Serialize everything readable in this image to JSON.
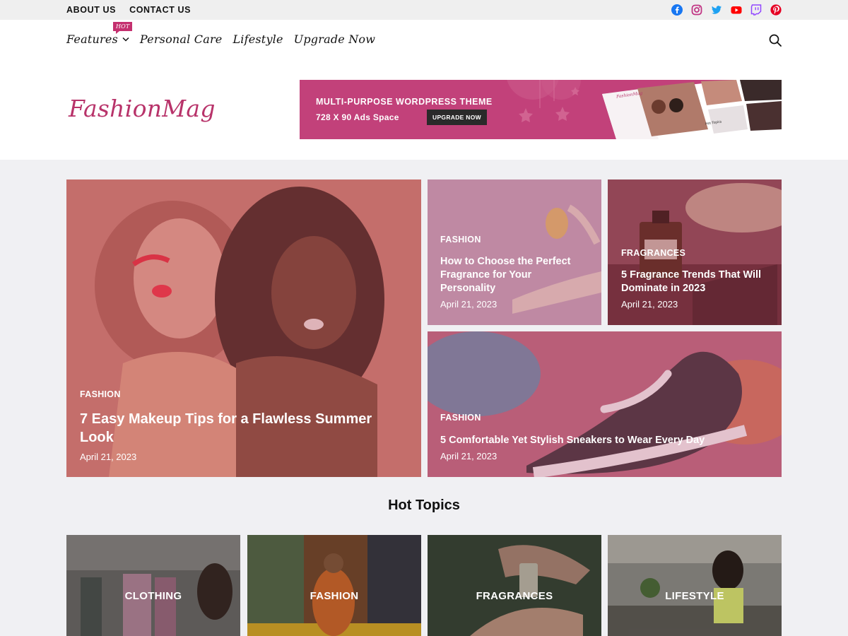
{
  "topbar": {
    "links": [
      "ABOUT US",
      "CONTACT US"
    ],
    "social_icons": [
      "facebook-icon",
      "instagram-icon",
      "twitter-icon",
      "youtube-icon",
      "twitch-icon",
      "pinterest-icon"
    ]
  },
  "nav": {
    "items": [
      "Features",
      "Personal Care",
      "Lifestyle",
      "Upgrade Now"
    ],
    "hot_badge": "HOT"
  },
  "logo": "FashionMag",
  "ad": {
    "line1": "MULTI-PURPOSE WORDPRESS THEME",
    "line2": "728 X 90 Ads Space",
    "button": "UPGRADE NOW",
    "mock_logo": "FashionMag",
    "mock_caption": "Hot Topics"
  },
  "posts": [
    {
      "category": "FASHION",
      "title": "7 Easy Makeup Tips for a Flawless Summer Look",
      "date": "April 21, 2023"
    },
    {
      "category": "FASHION",
      "title": "How to Choose the Perfect Fragrance for Your Personality",
      "date": "April 21, 2023"
    },
    {
      "category": "FRAGRANCES",
      "title": "5 Fragrance Trends That Will Dominate in 2023",
      "date": "April 21, 2023"
    },
    {
      "category": "FASHION",
      "title": "5 Comfortable Yet Stylish Sneakers to Wear Every Day",
      "date": "April 21, 2023"
    }
  ],
  "hot_topics": {
    "heading": "Hot Topics",
    "items": [
      "CLOTHING",
      "FASHION",
      "FRAGRANCES",
      "LIFESTYLE"
    ]
  },
  "colors": {
    "brand": "#b8336a",
    "accent": "#c4306f",
    "page_bg": "#f0f0f3"
  }
}
